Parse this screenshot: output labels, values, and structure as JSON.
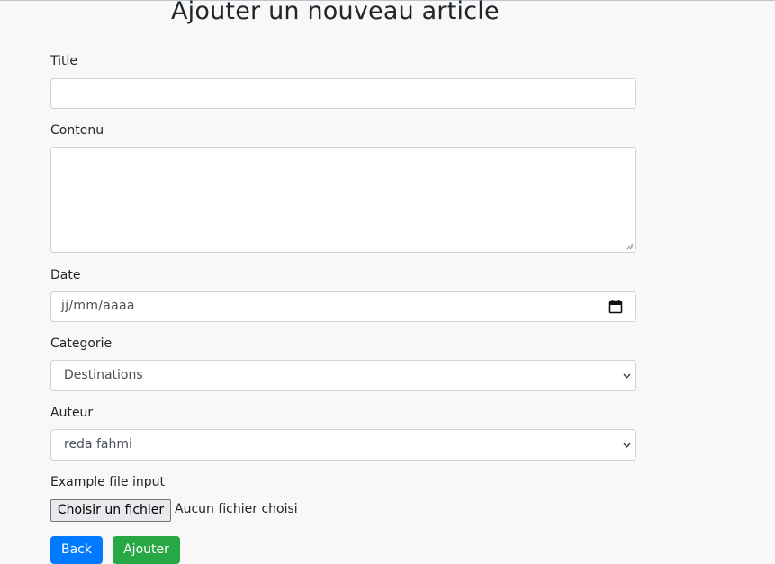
{
  "page": {
    "title": "Ajouter un nouveau article"
  },
  "form": {
    "title_label": "Title",
    "title_value": "",
    "content_label": "Contenu",
    "content_value": "",
    "date_label": "Date",
    "date_placeholder": "jj/mm/aaaa",
    "category_label": "Categorie",
    "category_selected": "Destinations",
    "author_label": "Auteur",
    "author_selected": "reda fahmi",
    "file_label": "Example file input",
    "file_button": "Choisir un fichier",
    "file_status": "Aucun fichier choisi"
  },
  "actions": {
    "back_label": "Back",
    "add_label": "Ajouter"
  },
  "colors": {
    "primary": "#007bff",
    "success": "#28a745",
    "background": "#f8f8f8"
  }
}
